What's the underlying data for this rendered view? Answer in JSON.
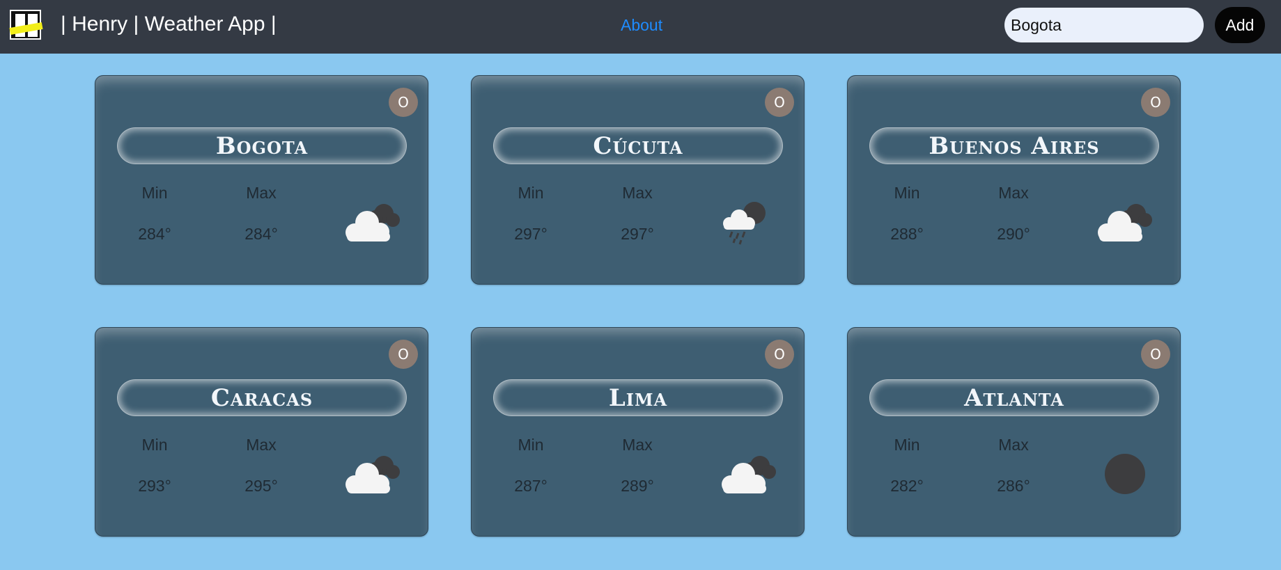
{
  "navbar": {
    "brand": "| Henry | Weather App |",
    "about_label": "About",
    "search_value": "Bogota",
    "add_label": "Add"
  },
  "cards": [
    {
      "city": "Bogota",
      "min_label": "Min",
      "max_label": "Max",
      "min": "284°",
      "max": "284°",
      "icon": "cloud-icon",
      "close_label": "O"
    },
    {
      "city": "Cúcuta",
      "min_label": "Min",
      "max_label": "Max",
      "min": "297°",
      "max": "297°",
      "icon": "rain-cloud-icon",
      "close_label": "O"
    },
    {
      "city": "Buenos Aires",
      "min_label": "Min",
      "max_label": "Max",
      "min": "288°",
      "max": "290°",
      "icon": "cloud-icon",
      "close_label": "O"
    },
    {
      "city": "Caracas",
      "min_label": "Min",
      "max_label": "Max",
      "min": "293°",
      "max": "295°",
      "icon": "cloud-icon",
      "close_label": "O"
    },
    {
      "city": "Lima",
      "min_label": "Min",
      "max_label": "Max",
      "min": "287°",
      "max": "289°",
      "icon": "cloud-icon",
      "close_label": "O"
    },
    {
      "city": "Atlanta",
      "min_label": "Min",
      "max_label": "Max",
      "min": "282°",
      "max": "286°",
      "icon": "dark-circle-icon",
      "close_label": "O"
    }
  ],
  "colors": {
    "background": "#8ac8f0",
    "navbar": "#343a44",
    "card": "#3e5e72",
    "link": "#1e8cff",
    "close_button": "#8b7b72"
  }
}
